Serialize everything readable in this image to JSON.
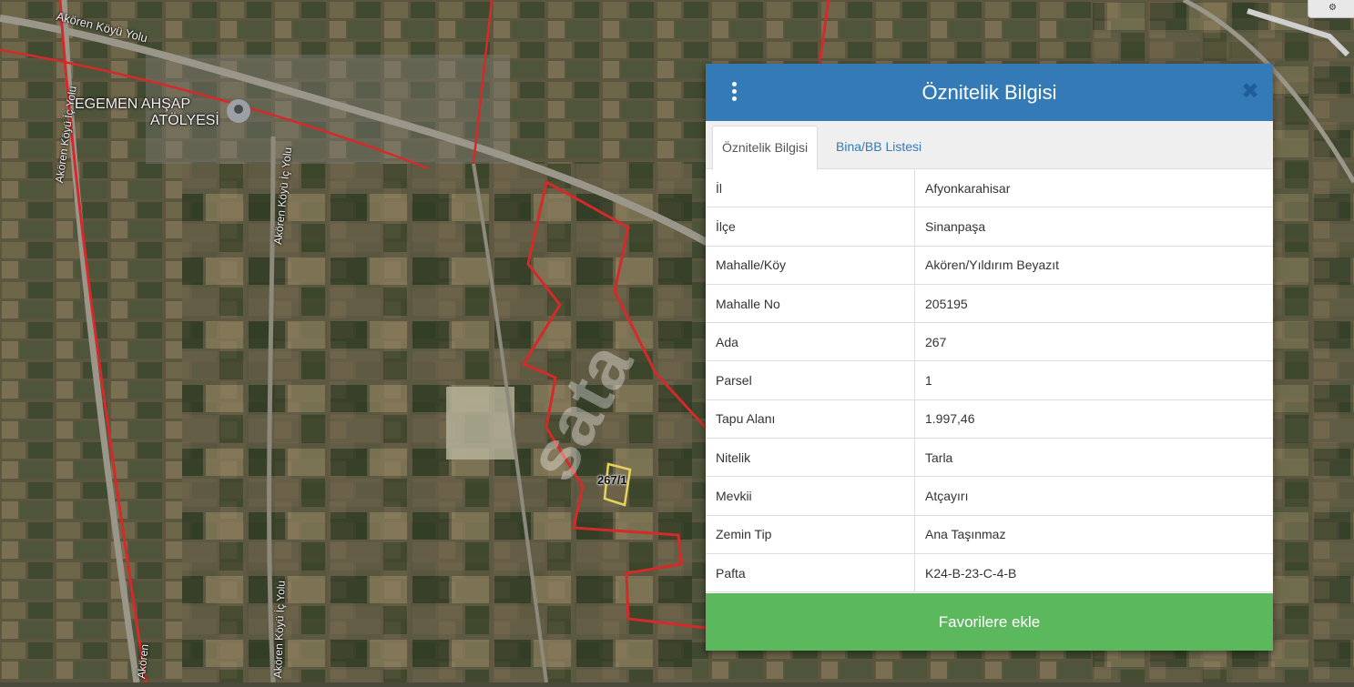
{
  "map": {
    "labels": {
      "road_top": "Akören Köyü Yolu",
      "road_left_vertical": "Akören Köyü İç Yolu",
      "road_center_vertical": "Akören Köyü İç Yolu",
      "road_bottom_vertical": "Akören Köyü İç Yolu",
      "road_bottom_left": "Akören",
      "poi_line1": "EGEMEN AHŞAP",
      "poi_line2": "ATÖLYESİ",
      "parcel": "267/1",
      "watermark": "sata"
    },
    "colors": {
      "boundary": "#d42a2a",
      "parcel_outline": "#e6d35a"
    }
  },
  "panel": {
    "title": "Öznitelik Bilgisi",
    "tabs": [
      {
        "label": "Öznitelik Bilgisi",
        "active": true
      },
      {
        "label": "Bina/BB Listesi",
        "active": false
      }
    ],
    "rows": [
      {
        "key": "İl",
        "value": "Afyonkarahisar"
      },
      {
        "key": "İlçe",
        "value": "Sinanpaşa"
      },
      {
        "key": "Mahalle/Köy",
        "value": "Akören/Yıldırım Beyazıt"
      },
      {
        "key": "Mahalle No",
        "value": "205195"
      },
      {
        "key": "Ada",
        "value": "267"
      },
      {
        "key": "Parsel",
        "value": "1"
      },
      {
        "key": "Tapu Alanı",
        "value": "1.997,46"
      },
      {
        "key": "Nitelik",
        "value": "Tarla"
      },
      {
        "key": "Mevkii",
        "value": "Atçayırı"
      },
      {
        "key": "Zemin Tip",
        "value": "Ana Taşınmaz"
      },
      {
        "key": "Pafta",
        "value": "K24-B-23-C-4-B"
      }
    ],
    "favorite_button": "Favorilere ekle",
    "colors": {
      "header": "#337ab7",
      "button": "#5cb85c"
    }
  }
}
